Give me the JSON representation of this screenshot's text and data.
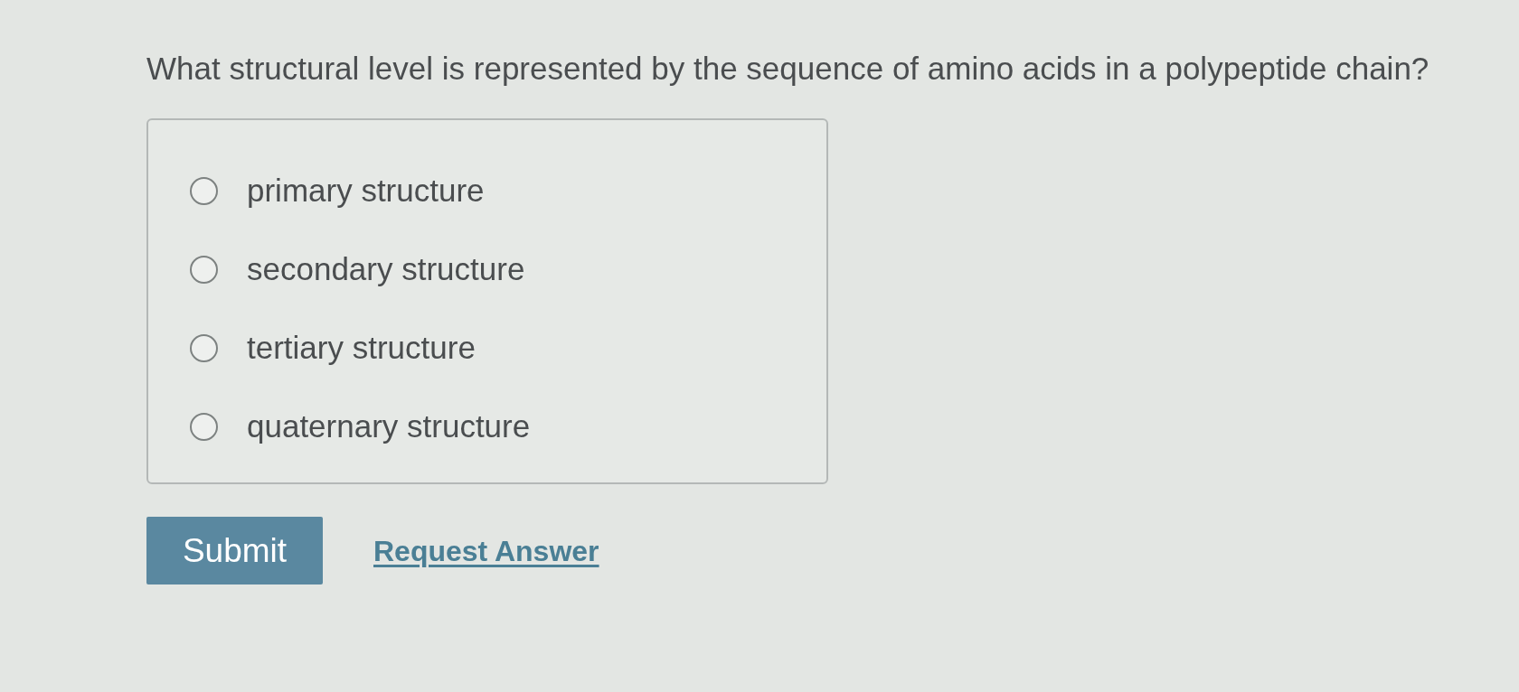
{
  "question": "What structural level is represented by the sequence of amino acids in a polypeptide chain?",
  "options": [
    {
      "label": "primary structure",
      "selected": false
    },
    {
      "label": "secondary structure",
      "selected": false
    },
    {
      "label": "tertiary structure",
      "selected": false
    },
    {
      "label": "quaternary structure",
      "selected": false
    }
  ],
  "submit_button": "Submit",
  "request_answer_link": "Request Answer"
}
